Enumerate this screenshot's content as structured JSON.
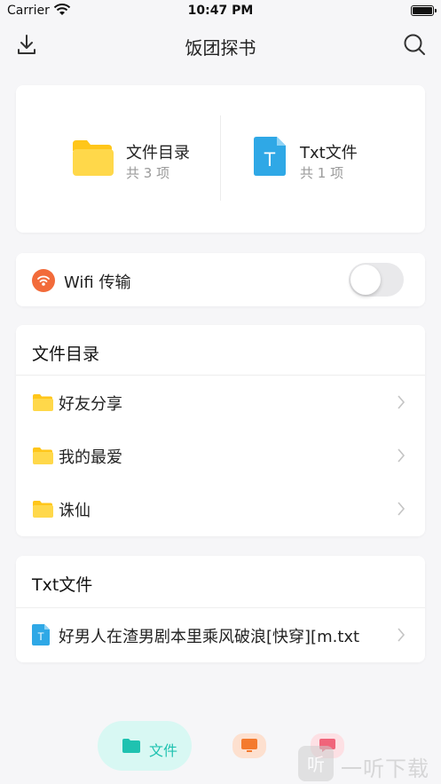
{
  "status_bar": {
    "carrier": "Carrier",
    "time": "10:47 PM"
  },
  "nav": {
    "title": "饭团探书"
  },
  "summary": {
    "folders": {
      "title": "文件目录",
      "count": "共 3 项"
    },
    "txt": {
      "title": "Txt文件",
      "count": "共 1 项",
      "icon_letter": "T"
    }
  },
  "wifi": {
    "label": "Wifi 传输",
    "enabled": false
  },
  "directory_section": {
    "title": "文件目录",
    "items": [
      {
        "label": "好友分享"
      },
      {
        "label": "我的最爱"
      },
      {
        "label": "诛仙"
      }
    ]
  },
  "txt_section": {
    "title": "Txt文件",
    "items": [
      {
        "label": "好男人在渣男剧本里乘风破浪[快穿][m.txt",
        "icon_letter": "T"
      }
    ]
  },
  "tabs": [
    {
      "label": "文件",
      "active": true,
      "icon": "folder-icon"
    },
    {
      "label": "",
      "active": false,
      "icon": "monitor-icon"
    },
    {
      "label": "",
      "active": false,
      "icon": "message-icon"
    }
  ],
  "watermark": {
    "text": "一听下载",
    "badge": "听"
  },
  "colors": {
    "accent": "#1fc2b0",
    "folder": "#ffd23f",
    "txt_icon": "#2fa8e6",
    "wifi": "#f26b3a",
    "background": "#f6f6f8"
  }
}
